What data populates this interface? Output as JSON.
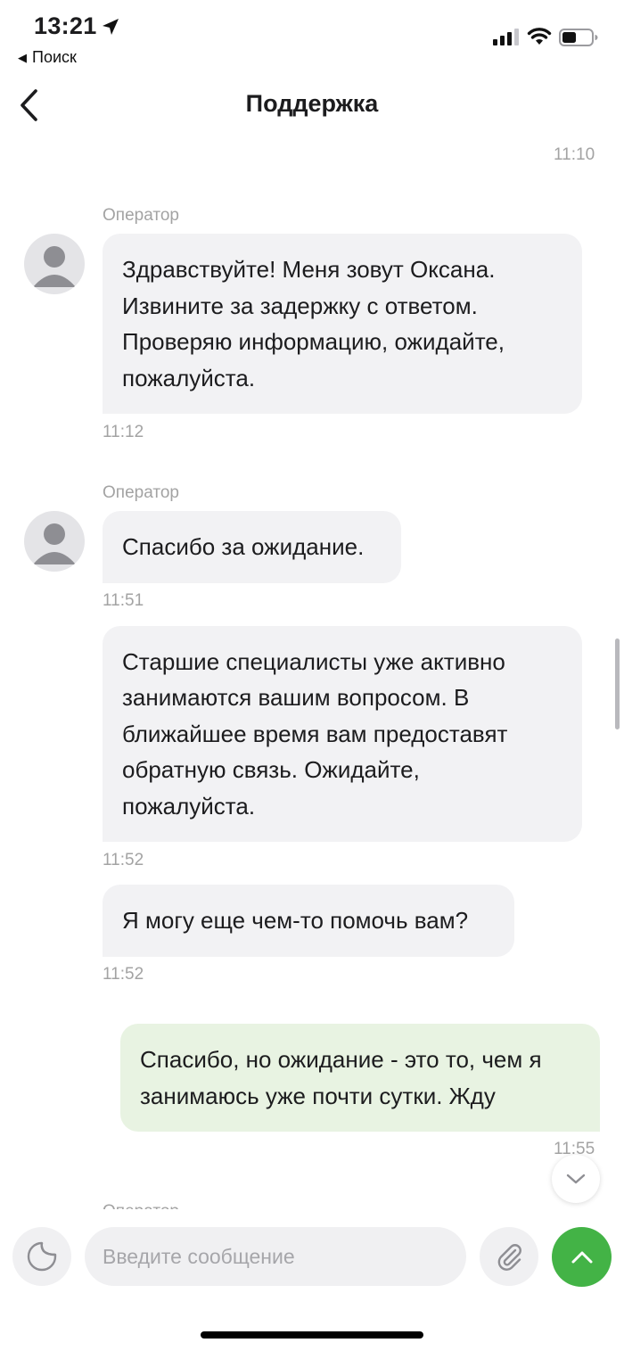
{
  "status_bar": {
    "time": "13:21",
    "back_app": "Поиск"
  },
  "header": {
    "title": "Поддержка"
  },
  "messages": [
    {
      "kind": "time",
      "text": "11:10"
    },
    {
      "kind": "incoming",
      "sender": "Оператор",
      "text": "Здравствуйте! Меня зовут Оксана. Извините за задержку с ответом. Проверяю информацию, ожидайте, пожалуйста.",
      "lines": [
        "Здравствуйте! Меня зовут Оксана.",
        "Извините за задержку с ответом.",
        "Проверяю информацию, ожидайте,",
        "пожалуйста."
      ],
      "time": "11:12"
    },
    {
      "kind": "incoming",
      "sender": "Оператор",
      "text": "Спасибо за ожидание.",
      "lines": [
        "Спасибо за ожидание."
      ],
      "time": "11:51"
    },
    {
      "kind": "incoming",
      "text": "Старшие специалисты уже активно занимаются вашим вопросом. В ближайшее время вам предоставят обратную связь. Ожидайте, пожалуйста.",
      "lines": [
        "Старшие специалисты уже активно",
        "занимаются вашим вопросом. В",
        "ближайшее время вам предоставят",
        "обратную связь. Ожидайте,",
        "пожалуйста."
      ],
      "time": "11:52"
    },
    {
      "kind": "incoming",
      "text": "Я могу еще чем-то помочь вам?",
      "lines": [
        "Я могу еще чем-то помочь вам?"
      ],
      "time": "11:52"
    },
    {
      "kind": "outgoing",
      "text": "Спасибо, но ожидание - это то, чем я занимаюсь уже почти сутки. Жду",
      "lines": [
        "Спасибо, но ожидание - это то, чем я",
        "занимаюсь уже почти сутки. Жду"
      ],
      "time": "11:55"
    },
    {
      "kind": "incoming",
      "sender": "Оператор"
    }
  ],
  "composer": {
    "placeholder": "Введите сообщение"
  },
  "colors": {
    "accent": "#43b346",
    "incoming_bubble": "#f2f2f4",
    "outgoing_bubble": "#e8f3e2",
    "meta_text": "#a3a3a3"
  },
  "icons": [
    "location-arrow-icon",
    "signal-icon",
    "wifi-icon",
    "battery-icon",
    "chevron-left-icon",
    "avatar-icon",
    "chevron-down-icon",
    "sticker-icon",
    "paperclip-icon",
    "arrow-up-icon"
  ]
}
